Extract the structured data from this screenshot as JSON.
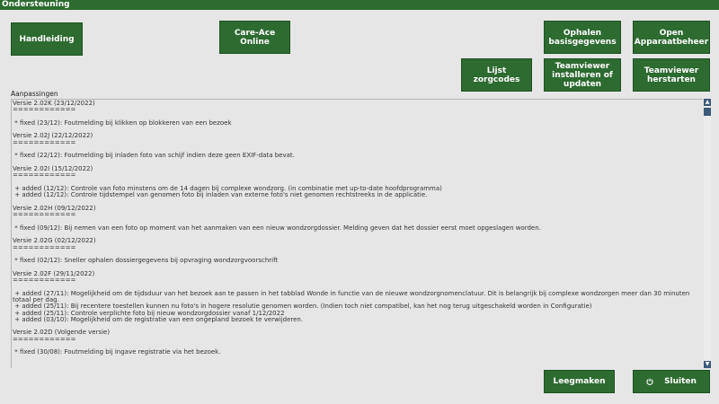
{
  "window": {
    "title": "Ondersteuning"
  },
  "buttons": {
    "handleiding": "Handleiding",
    "careace": "Care-Ace\nOnline",
    "ophalen": "Ophalen\nbasisgegevens",
    "apparaatbeheer": "Open\nApparaatbeheer",
    "zorgcodes": "Lijst\nzorgcodes",
    "teamviewer_install": "Teamviewer\ninstalleren of\nupdaten",
    "teamviewer_restart": "Teamviewer\nherstarten",
    "leegmaken": "Leegmaken",
    "sluiten": "Sluiten"
  },
  "section": {
    "label": "Aanpassingen"
  },
  "log": {
    "text": "Versie 2.02K (23/12/2022)\n============\n\n * fixed (23/12): Foutmelding bij klikken op blokkeren van een bezoek\n\nVersie 2.02J (22/12/2022)\n============\n\n * fixed (22/12): Foutmelding bij inladen foto van schijf indien deze geen EXIF-data bevat.\n\nVersie 2.02I (15/12/2022)\n============\n\n + added (12/12): Controle van foto minstens om de 14 dagen bij complexe wondzorg. (in combinatie met up-to-date hoofdprogramma)\n + added (12/12): Controle tijdstempel van genomen foto bij inladen van externe foto's niet genomen rechtstreeks in de applicatie.\n\nVersie 2.02H (09/12/2022)\n============\n\n * fixed (09/12): Bij nemen van een foto op moment van het aanmaken van een nieuw wondzorgdossier. Melding geven dat het dossier eerst moet opgeslagen worden.\n\nVersie 2.02G (02/12/2022)\n============\n\n * fixed (02/12): Sneller ophalen dossiergegevens bij opvraging wondzorgvoorschrift\n\nVersie 2.02F (29/11/2022)\n============\n\n + added (27/11): Mogelijkheid om de tijdsduur van het bezoek aan te passen in het tabblad Wonde in functie van de nieuwe wondzorgnomenclatuur. Dit is belangrijk bij complexe wondzorgen meer dan 30 minuten totaal per dag.\n + added (25/11): Bij recentere toestellen kunnen nu foto's in hogere resolutie genomen worden. (Indien toch niet compatibel, kan het nog terug uitgeschakeld worden in Configuratie)\n + added (25/11): Controle verplichte foto bij nieuw wondzorgdossier vanaf 1/12/2022\n + added (03/10): Mogelijkheid om de registratie van een ongepland bezoek te verwijderen.\n\nVersie 2.02D (Volgende versie)\n============\n\n * fixed (30/08): Foutmelding bij ingave registratie via het bezoek."
  },
  "icons": {
    "sluiten": "power-icon",
    "scroll_up": "arrow-up-icon",
    "scroll_down": "arrow-down-icon"
  },
  "colors": {
    "accent": "#2d6b30",
    "background": "#e6e6e6",
    "scrollbar": "#3b5a7a"
  }
}
